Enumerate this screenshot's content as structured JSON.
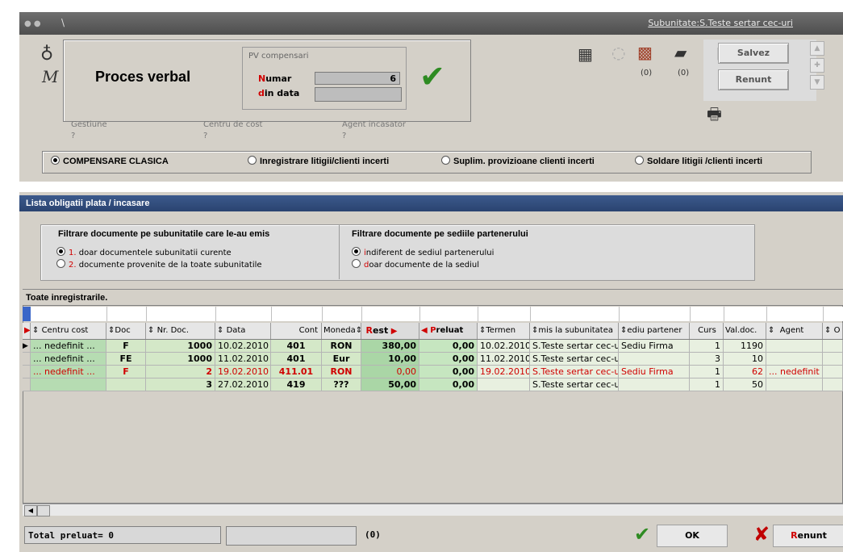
{
  "titlebar": {
    "symbol": "\\",
    "subunitate": "Subunitate:S.Teste sertar cec-uri"
  },
  "header": {
    "title": "Proces verbal",
    "pv_group": "PV compensari",
    "numar_label_first": "N",
    "numar_label_rest": "umar",
    "data_label_first": "d",
    "data_label_rest": "in data",
    "numar_value": "6",
    "data_value": ""
  },
  "fields": {
    "gestiune_label": "Gestiune",
    "gestiune_value": "?",
    "centru_label": "Centru de cost",
    "centru_value": "?",
    "agent_label": "Agent incasator",
    "agent_value": "?"
  },
  "toolbar": {
    "count1": "(0)",
    "count2": "(0)",
    "salvez": "Salvez",
    "renunt": "Renunt"
  },
  "mode_options": [
    {
      "label": "COMPENSARE CLASICA",
      "selected": true
    },
    {
      "label": "Inregistrare litigii/clienti incerti",
      "selected": false
    },
    {
      "label": "Suplim. provizioane clienti incerti",
      "selected": false
    },
    {
      "label": "Soldare litigii /clienti incerti",
      "selected": false
    }
  ],
  "list": {
    "title": "Lista obligatii plata / incasare",
    "grid_title": "Toate inregistrarile."
  },
  "filter1": {
    "title": "Filtrare documente pe subunitatile care le-au emis",
    "opt1_num": "1.",
    "opt1_text": "doar documentele subunitatii curente",
    "opt2_num": "2.",
    "opt2_text": "documente provenite de la toate subunitatile"
  },
  "filter2": {
    "title": "Filtrare documente pe sediile partenerului",
    "opt1_first": "i",
    "opt1_text": "ndiferent de sediul partenerului",
    "opt2_first": "d",
    "opt2_text": "oar documente de la sediul"
  },
  "columns": [
    "Centru cost",
    "Doc",
    "Nr. Doc.",
    "Data",
    "Cont",
    "Moneda",
    "Rest",
    "Preluat",
    "Termen",
    "mis la subunitatea",
    "ediu partener",
    "Curs",
    "Val.doc.",
    "Agent",
    "O"
  ],
  "rows": [
    {
      "centru": "... nedefinit ...",
      "doc": "F",
      "nr": "1000",
      "data": "10.02.2010",
      "cont": "401",
      "moneda": "RON",
      "rest": "380,00",
      "preluat": "0,00",
      "termen": "10.02.2010",
      "subunit": "S.Teste sertar cec-u",
      "sediu": "Sediu Firma",
      "curs": "1",
      "val": "1190",
      "agent": "",
      "red": false
    },
    {
      "centru": "... nedefinit ...",
      "doc": "FE",
      "nr": "1000",
      "data": "11.02.2010",
      "cont": "401",
      "moneda": "Eur",
      "rest": "10,00",
      "preluat": "0,00",
      "termen": "11.02.2010",
      "subunit": "S.Teste sertar cec-u",
      "sediu": "",
      "curs": "3",
      "val": "10",
      "agent": "",
      "red": false
    },
    {
      "centru": "... nedefinit ...",
      "doc": "F",
      "nr": "2",
      "data": "19.02.2010",
      "cont": "411.01",
      "moneda": "RON",
      "rest": "0,00",
      "preluat": "0,00",
      "termen": "19.02.2010",
      "subunit": "S.Teste sertar cec-u",
      "sediu": "Sediu Firma",
      "curs": "1",
      "val": "62",
      "agent": "... nedefinit ..",
      "red": true
    },
    {
      "centru": "",
      "doc": "",
      "nr": "3",
      "data": "27.02.2010",
      "cont": "419",
      "moneda": "???",
      "rest": "50,00",
      "preluat": "0,00",
      "termen": "",
      "subunit": "S.Teste sertar cec-u",
      "sediu": "",
      "curs": "1",
      "val": "50",
      "agent": "",
      "red": false
    }
  ],
  "footer": {
    "total": "Total preluat= 0",
    "count": "(0)",
    "ok_label": "OK",
    "renunt_first": "R",
    "renunt_rest": "enunt"
  }
}
